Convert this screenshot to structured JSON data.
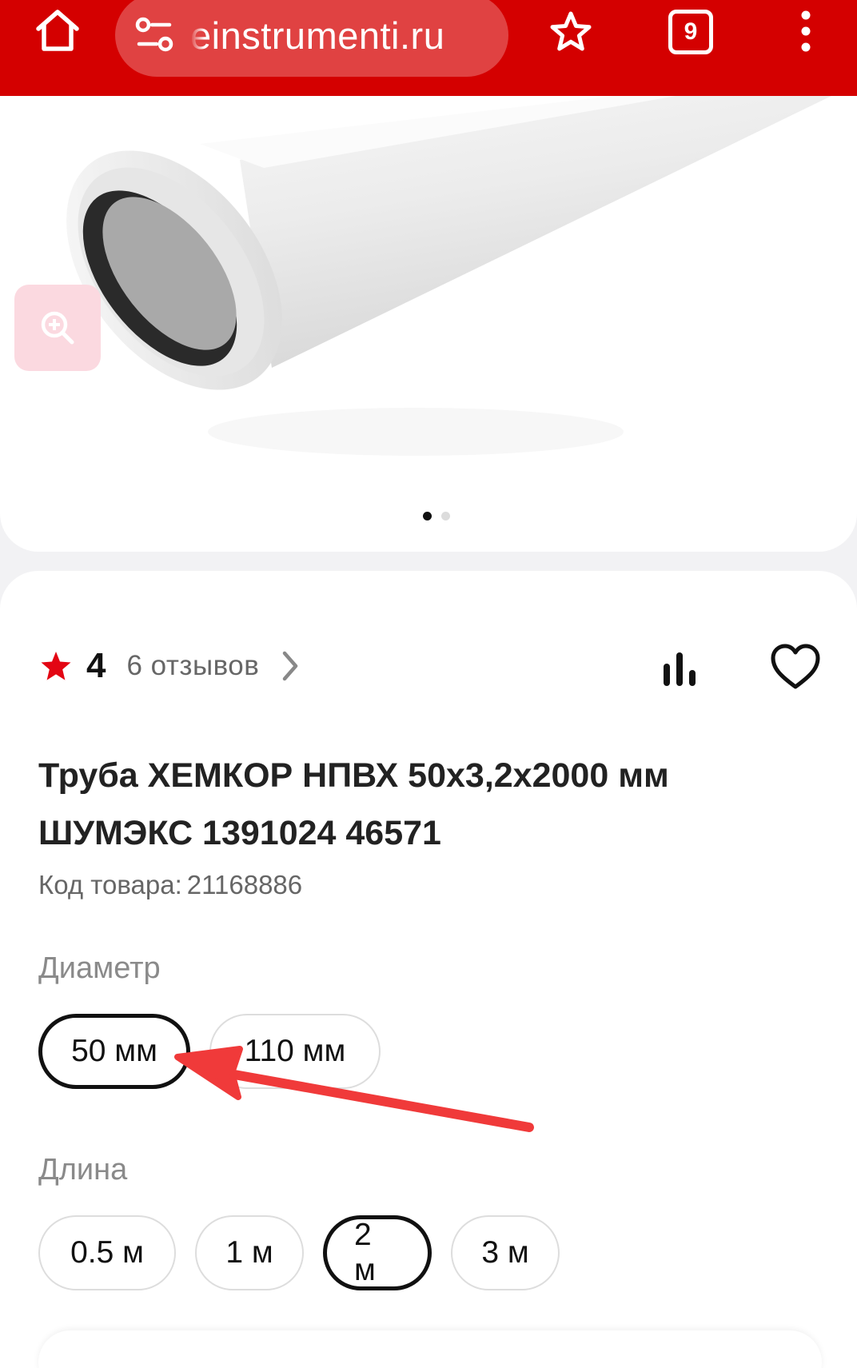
{
  "browser": {
    "url": "einstrumenti.ru",
    "tab_count": "9",
    "theme_color": "#d40000",
    "icons": [
      "home-icon",
      "site-settings-icon",
      "bookmark-star-icon",
      "tab-switcher-icon",
      "overflow-menu-icon"
    ]
  },
  "gallery": {
    "image_alt": "Труба ХЕМКОР НПВХ",
    "slides": 2,
    "active_slide": 1,
    "zoom_icon": "zoom-in-icon"
  },
  "product": {
    "rating": "4",
    "reviews": "6 отзывов",
    "title_line1": "Труба ХЕМКОР НПВХ 50х3,2х2000 мм",
    "title_line2": "ШУМЭКС 1391024 46571",
    "sku_label": "Код товара:",
    "sku_value": "21168886",
    "accent_color": "#e30613"
  },
  "options": {
    "diameter": {
      "label": "Диаметр",
      "values": [
        "50 мм",
        "110 мм"
      ],
      "selected": "50 мм"
    },
    "length": {
      "label": "Длина",
      "values": [
        "0.5 м",
        "1 м",
        "2 м",
        "3 м"
      ],
      "selected": "2 м"
    }
  },
  "annotation": {
    "arrow_color": "#f03a3a",
    "points_to": "50 мм"
  }
}
